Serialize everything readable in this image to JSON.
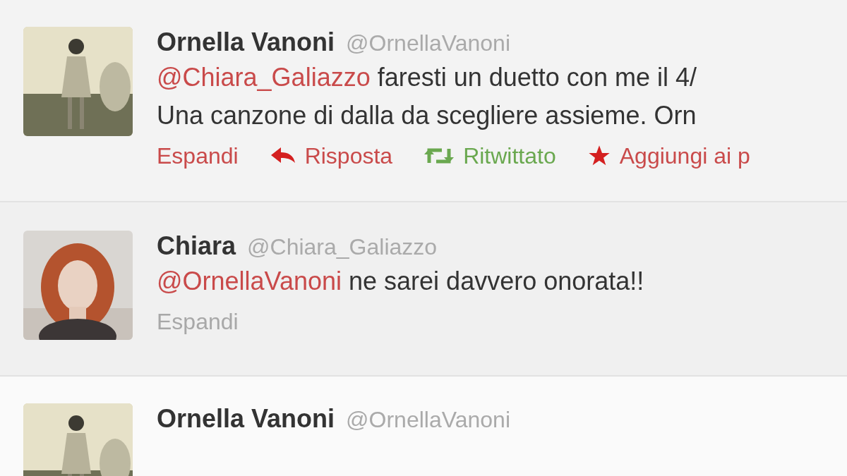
{
  "tweets": [
    {
      "name": "Ornella Vanoni",
      "handle": "@OrnellaVanoni",
      "lines": [
        [
          {
            "kind": "mention",
            "text": "@Chiara_Galiazzo"
          },
          {
            "kind": "text",
            "text": " faresti un duetto con me il 4/"
          }
        ],
        [
          {
            "kind": "text",
            "text": "Una canzone di dalla da scegliere assieme. Orn"
          }
        ]
      ],
      "actions": [
        {
          "kind": "expand",
          "label": "Espandi",
          "active": true
        },
        {
          "kind": "reply",
          "label": "Risposta",
          "active": true
        },
        {
          "kind": "retweet",
          "label": "Ritwittato",
          "active": true
        },
        {
          "kind": "favorite",
          "label": "Aggiungi ai p",
          "active": true
        }
      ]
    },
    {
      "name": "Chiara",
      "handle": "@Chiara_Galiazzo",
      "lines": [
        [
          {
            "kind": "mention",
            "text": "@OrnellaVanoni"
          },
          {
            "kind": "text",
            "text": " ne sarei davvero onorata!!"
          }
        ]
      ],
      "actions": [
        {
          "kind": "expand",
          "label": "Espandi",
          "active": false
        }
      ]
    },
    {
      "name": "Ornella Vanoni",
      "handle": "@OrnellaVanoni"
    }
  ]
}
